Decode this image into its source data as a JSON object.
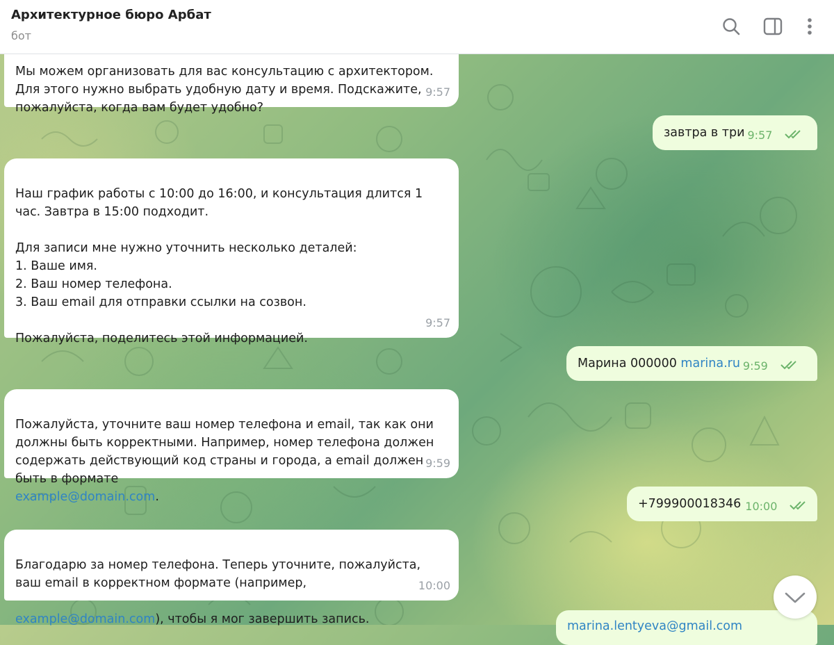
{
  "header": {
    "title": "Архитектурное бюро Арбат",
    "subtitle": "бот",
    "icons": [
      "search-icon",
      "sidebar-toggle-icon",
      "more-vertical-icon"
    ]
  },
  "messages": [
    {
      "side": "in",
      "text_top": "Мы можем организовать для вас консультацию с архитектором.",
      "text": "Для этого нужно выбрать удобную дату и время. Подскажите,\nпожалуйста, когда вам будет удобно?",
      "time": "9:57"
    },
    {
      "side": "out",
      "text": "завтра в три",
      "time": "9:57"
    },
    {
      "side": "in",
      "text": "Наш график работы с 10:00 до 16:00, и консультация длится 1\nчас. Завтра в 15:00 подходит.\n\nДля записи мне нужно уточнить несколько деталей:\n1. Ваше имя.\n2. Ваш номер телефона.\n3. Ваш email для отправки ссылки на созвон.\n\nПожалуйста, поделитесь этой информацией.",
      "time": "9:57"
    },
    {
      "side": "out",
      "text": "Марина 000000",
      "link": "marina.ru",
      "time": "9:59"
    },
    {
      "side": "in",
      "text": "Пожалуйста, уточните ваш номер телефона и email, так как они\nдолжны быть корректными. Например, номер телефона должен\nсодержать действующий код страны и города, а email должен\nбыть в формате",
      "link": "example@domain.com",
      "text_after": ".",
      "time": "9:59"
    },
    {
      "side": "out",
      "text": "+799900018346",
      "time": "10:00"
    },
    {
      "side": "in",
      "text": "Благодарю за номер телефона. Теперь уточните, пожалуйста,\nваш email в корректном формате (например,",
      "link": "example@domain.com",
      "text_after": "), чтобы я мог завершить запись.",
      "time": "10:00"
    },
    {
      "side": "out",
      "link": "marina.lentyeva@gmail.com"
    }
  ],
  "scroll_button_icon": "chevron-down-icon",
  "colors": {
    "outgoing_bubble": "#effdde",
    "incoming_bubble": "#ffffff",
    "link": "#2f84c4",
    "out_time": "#6bb36a"
  }
}
